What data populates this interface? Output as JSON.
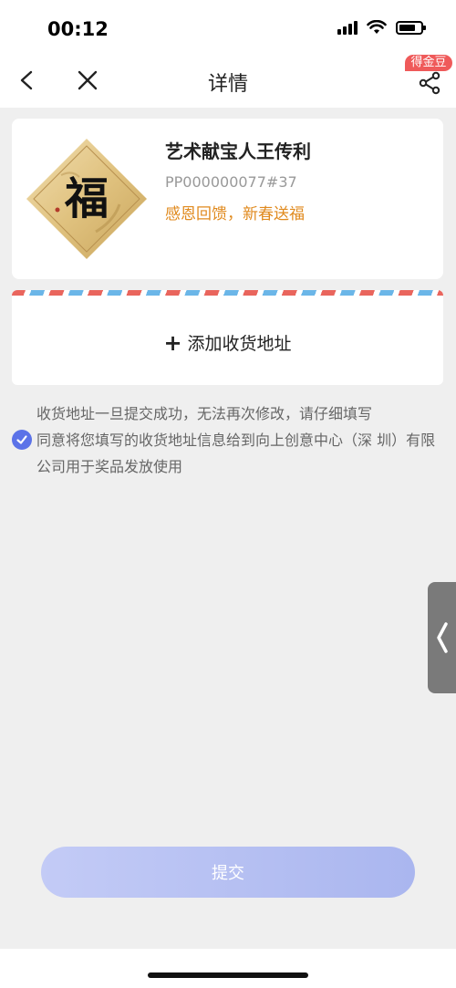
{
  "status": {
    "time": "00:12"
  },
  "nav": {
    "title": "详情",
    "badge": "得金豆"
  },
  "prize": {
    "title": "艺术献宝人王传利",
    "code": "PP000000077#37",
    "slogan": "感恩回馈，新春送福",
    "image_char": "福"
  },
  "address": {
    "add_label": "添加收货地址"
  },
  "notice": "收货地址一旦提交成功，无法再次修改，请仔细填写",
  "consent": {
    "text": "同意将您填写的收货地址信息给到向上创意中心（深 圳）有限公司用于奖品发放使用",
    "checked": true
  },
  "submit_label": "提交",
  "colors": {
    "accent": "#5b72e8",
    "slogan": "#e08a1e",
    "badge": "#ef5a5a"
  }
}
